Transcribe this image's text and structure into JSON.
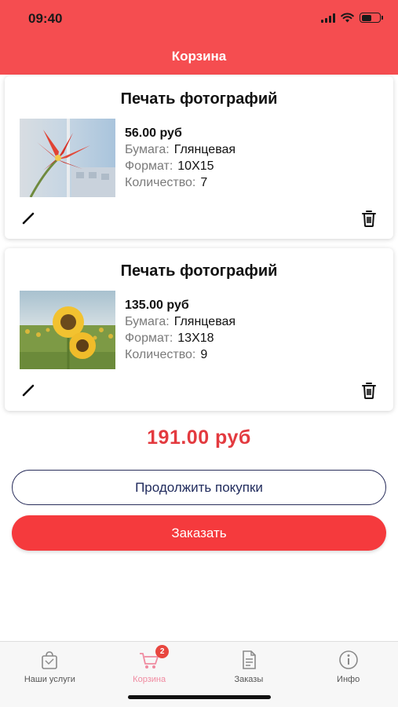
{
  "status_bar": {
    "time": "09:40"
  },
  "header": {
    "title": "Корзина"
  },
  "cart_items": [
    {
      "title": "Печать фотографий",
      "image": "red-lily-photo",
      "price": "56.00 руб",
      "paper_label": "Бумага:",
      "paper_value": "Глянцевая",
      "format_label": "Формат:",
      "format_value": "10X15",
      "quantity_label": "Количество:",
      "quantity_value": "7"
    },
    {
      "title": "Печать фотографий",
      "image": "sunflowers-photo",
      "price": "135.00 руб",
      "paper_label": "Бумага:",
      "paper_value": "Глянцевая",
      "format_label": "Формат:",
      "format_value": "13X18",
      "quantity_label": "Количество:",
      "quantity_value": "9"
    }
  ],
  "total": "191.00 руб",
  "buttons": {
    "continue_label": "Продолжить покупки",
    "order_label": "Заказать"
  },
  "tabbar": {
    "tabs": [
      {
        "label": "Наши услуги",
        "icon": "shopping-bag-icon"
      },
      {
        "label": "Корзина",
        "icon": "cart-icon",
        "badge": "2",
        "active": true
      },
      {
        "label": "Заказы",
        "icon": "document-icon"
      },
      {
        "label": "Инфо",
        "icon": "info-icon"
      }
    ]
  },
  "colors": {
    "header": "#f54d50",
    "accent": "#f53a3d",
    "total": "#e33a3f",
    "outline_button": "#2a2f5c",
    "active_tab": "#f08aa0"
  }
}
